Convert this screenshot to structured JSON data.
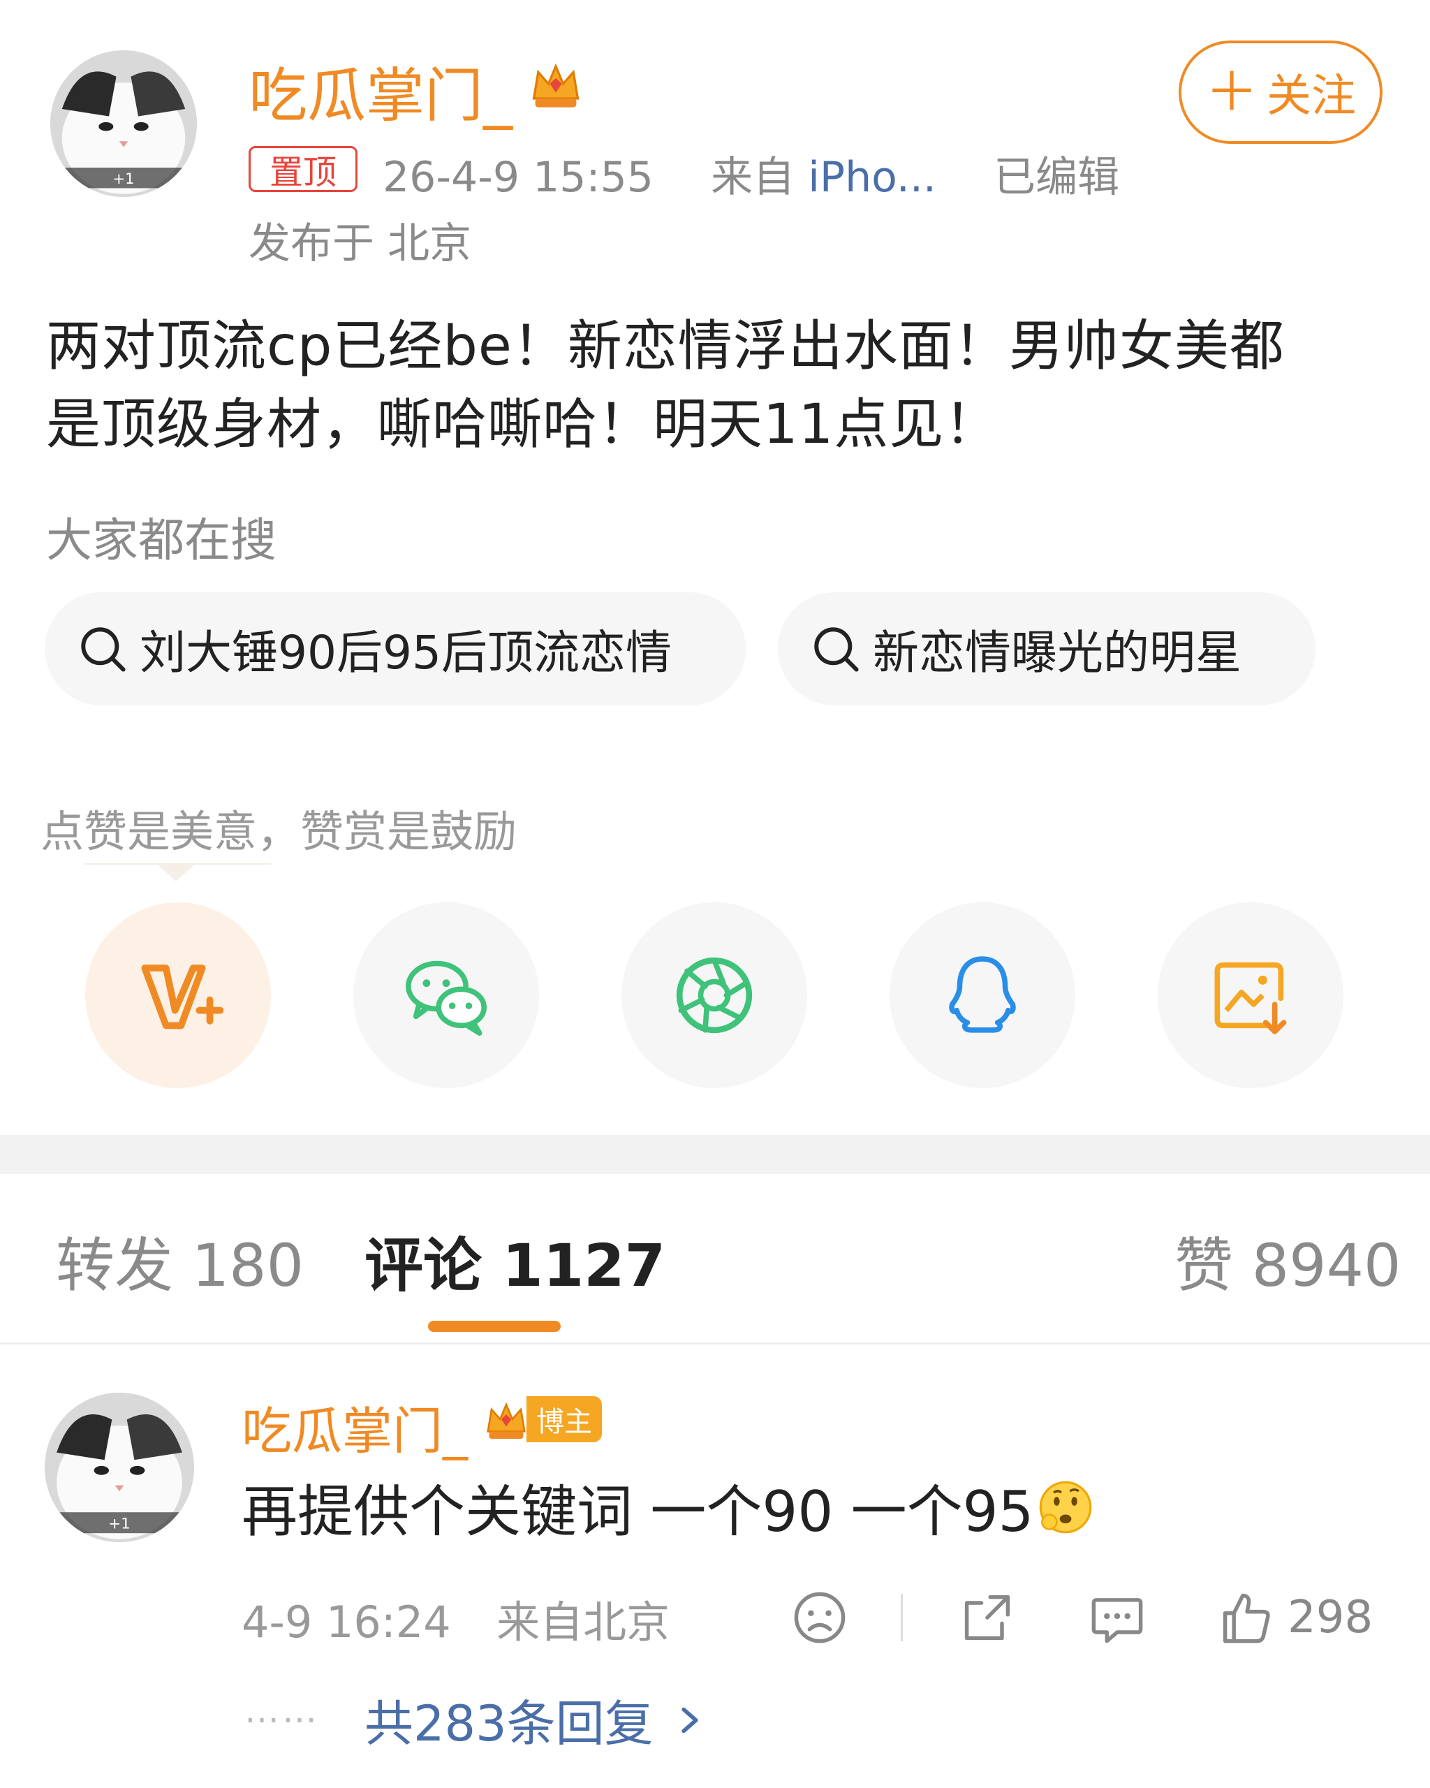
{
  "post": {
    "author": "吃瓜掌门_",
    "follow_label": "关注",
    "pin_label": "置顶",
    "time": "26-4-9 15:55",
    "source_prefix": "来自",
    "source_device": "iPho...",
    "edited": "已编辑",
    "location": "发布于 北京",
    "content_line1": "两对顶流cp已经be！新恋情浮出水面！男帅女美都",
    "content_line2": "是顶级身材，嘶哈嘶哈！明天11点见！"
  },
  "search": {
    "title": "大家都在搜",
    "items": [
      {
        "label": "刘大锤90后95后顶流恋情"
      },
      {
        "label": "新恋情曝光的明星"
      }
    ]
  },
  "reward": {
    "title": "点赞是美意，赞赏是鼓励"
  },
  "share": {
    "icons": [
      "vplus-icon",
      "wechat-icon",
      "moments-icon",
      "qq-icon",
      "save-image-icon"
    ]
  },
  "tabs": {
    "repost_label": "转发",
    "repost_count": "180",
    "comment_label": "评论",
    "comment_count": "1127",
    "like_label": "赞",
    "like_count": "8940"
  },
  "comment": {
    "author": "吃瓜掌门_",
    "badge": "博主",
    "text": "再提供个关键词 一个90 一个95",
    "time": "4-9 16:24",
    "location": "来自北京",
    "like_count": "298",
    "dots": "……",
    "replies": "共283条回复"
  },
  "colors": {
    "accent": "#f08a24",
    "pin_red": "#e8453c",
    "link_blue": "#4a6ea8",
    "wechat_green": "#3fc27a",
    "qq_blue": "#2a8ee8"
  }
}
